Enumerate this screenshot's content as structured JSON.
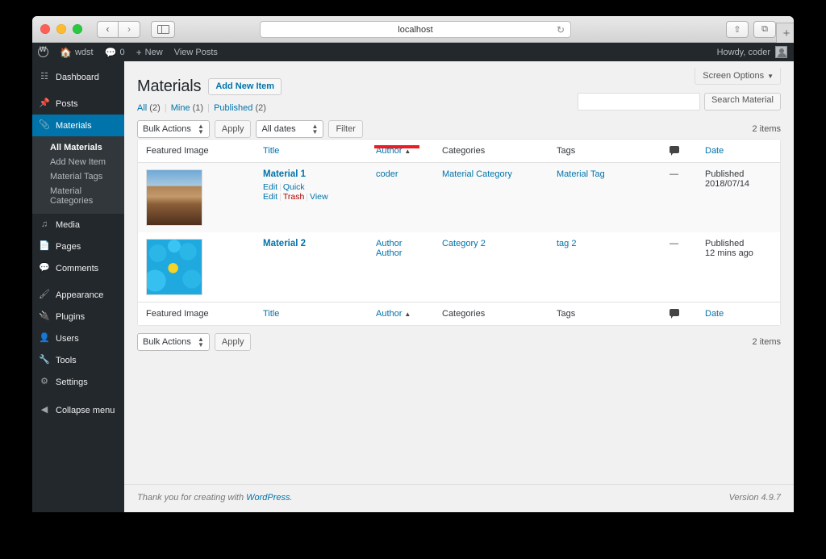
{
  "browser": {
    "url": "localhost",
    "reload_icon": "reload-icon",
    "back_icon": "‹",
    "forward_icon": "›",
    "share_icon": "⇧",
    "tabs_icon": "⧉",
    "newtab_icon": "+"
  },
  "adminbar": {
    "logo": "wp-logo-icon",
    "site_name": "wdst",
    "comments_count": "0",
    "new_label": "New",
    "view_posts_label": "View Posts",
    "howdy": "Howdy, coder"
  },
  "sidebar": {
    "items": [
      {
        "label": "Dashboard",
        "icon": "dashboard-icon",
        "active": false
      },
      {
        "label": "Posts",
        "icon": "pin-icon",
        "active": false
      },
      {
        "label": "Materials",
        "icon": "paperclip-icon",
        "active": true
      },
      {
        "label": "Media",
        "icon": "media-icon",
        "active": false
      },
      {
        "label": "Pages",
        "icon": "pages-icon",
        "active": false
      },
      {
        "label": "Comments",
        "icon": "comments-icon",
        "active": false
      },
      {
        "label": "Appearance",
        "icon": "brush-icon",
        "active": false
      },
      {
        "label": "Plugins",
        "icon": "plug-icon",
        "active": false
      },
      {
        "label": "Users",
        "icon": "user-icon",
        "active": false
      },
      {
        "label": "Tools",
        "icon": "wrench-icon",
        "active": false
      },
      {
        "label": "Settings",
        "icon": "settings-icon",
        "active": false
      }
    ],
    "submenu": [
      {
        "label": "All Materials",
        "current": true
      },
      {
        "label": "Add New Item",
        "current": false
      },
      {
        "label": "Material Tags",
        "current": false
      },
      {
        "label": "Material Categories",
        "current": false
      }
    ],
    "collapse": {
      "label": "Collapse menu",
      "icon": "collapse-icon"
    }
  },
  "screen_options": {
    "label": "Screen Options",
    "caret": "▼"
  },
  "page": {
    "title": "Materials",
    "add_new_label": "Add New Item"
  },
  "filters": {
    "all_label": "All",
    "all_count": "(2)",
    "mine_label": "Mine",
    "mine_count": "(1)",
    "published_label": "Published",
    "published_count": "(2)",
    "separator": "|"
  },
  "search": {
    "value": "",
    "placeholder": "",
    "button_label": "Search Material"
  },
  "tablenav": {
    "bulk_actions": "Bulk Actions",
    "apply_label": "Apply",
    "dates": "All dates",
    "filter_label": "Filter",
    "items_count": "2 items",
    "items_count_bottom": "2 items"
  },
  "table": {
    "columns": [
      {
        "label": "Featured Image",
        "link": false,
        "sorted": false
      },
      {
        "label": "Title",
        "link": true,
        "sorted": false
      },
      {
        "label": "Author",
        "link": true,
        "sorted": true,
        "sort_arrow": "▲"
      },
      {
        "label": "Categories",
        "link": false,
        "sorted": false
      },
      {
        "label": "Tags",
        "link": false,
        "sorted": false
      },
      {
        "label": "",
        "link": false,
        "sorted": false,
        "icon": "comment-bubble-icon"
      },
      {
        "label": "Date",
        "link": true,
        "sorted": false
      }
    ],
    "rows": [
      {
        "thumb": "sand-dune-thumbnail",
        "title": "Material 1",
        "actions": {
          "edit": "Edit",
          "quick_edit": "Quick Edit",
          "trash": "Trash",
          "view": "View"
        },
        "author": "coder",
        "categories": "Material Category",
        "tags": "Material Tag",
        "comments": "—",
        "date_status": "Published",
        "date_value": "2018/07/14"
      },
      {
        "thumb": "smileys-thumbnail",
        "title": "Material 2",
        "actions": null,
        "author": "Author Author",
        "categories": "Category 2",
        "tags": "tag 2",
        "comments": "—",
        "date_status": "Published",
        "date_value": "12 mins ago"
      }
    ]
  },
  "footer": {
    "thanks_pre": "Thank you for creating with ",
    "wordpress_link": "WordPress",
    "thanks_post": ".",
    "version": "Version 4.9.7"
  },
  "colors": {
    "accent": "#0073aa",
    "admin_bg": "#23282d",
    "submenu_bg": "#32373c",
    "link": "#0073aa",
    "trash": "#a00",
    "annotation": "#ec1c24"
  }
}
